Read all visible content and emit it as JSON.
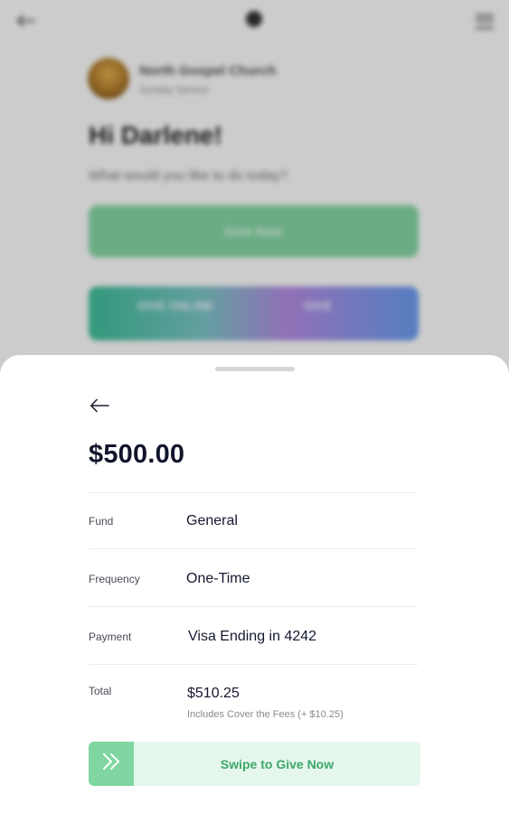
{
  "background": {
    "church_name": "North Gospel Church",
    "church_subtitle": "Sunday Service",
    "greeting": "Hi Darlene!",
    "question": "What would you like to do today?",
    "give_button_label": "Give Now",
    "promo_left": "GIVE ONLINE",
    "promo_right": "GIVE",
    "give_button_color": "#86d8a6"
  },
  "sheet": {
    "amount": "$500.00",
    "rows": [
      {
        "label": "Fund",
        "value": "General"
      },
      {
        "label": "Frequency",
        "value": "One-Time"
      },
      {
        "label": "Payment",
        "value": "Visa Ending in 4242"
      },
      {
        "label": "Total",
        "value": "$510.25"
      }
    ],
    "total_note": "Includes Cover the Fees (+ $10.25)",
    "swipe_label": "Swipe to Give Now",
    "accent_color": "#7fd6a0",
    "icons": {
      "back": "arrow-left-icon",
      "swipe": "double-chevron-right-icon"
    }
  }
}
